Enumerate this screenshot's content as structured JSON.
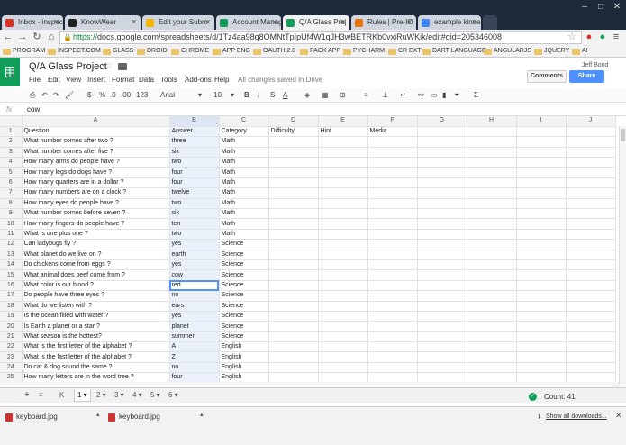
{
  "browser": {
    "tabs": [
      {
        "label": "Inbox - inspect",
        "color": "#d93025"
      },
      {
        "label": "KnowWear",
        "color": "#222222"
      },
      {
        "label": "Edit your Subm",
        "color": "#f4b400"
      },
      {
        "label": "Account Manag",
        "color": "#0f9d58"
      },
      {
        "label": "Q/A Glass Proj",
        "color": "#0f9d58"
      },
      {
        "label": "Rules | Pre-IO",
        "color": "#e8710a"
      },
      {
        "label": "example kinde",
        "color": "#4285f4"
      }
    ],
    "url_scheme": "https://",
    "url_rest": "docs.google.com/spreadsheets/d/1Tz4aa98g8OMNtTpIpUf4W1qJH3wBETRKb0vxiRuWKik/edit#gid=205346008",
    "bookmarks": [
      "PROGRAM",
      "INSPECT.COM",
      "GLASS",
      "DROID",
      "CHROME",
      "APP ENG",
      "OAUTH 2.0",
      "PACK APP",
      "PYCHARM",
      "CR EXT",
      "DART LANGUAGE",
      "ANGULARJS",
      "JQUERY",
      "AI"
    ]
  },
  "doc": {
    "title": "Q/A Glass Project",
    "menu": [
      "File",
      "Edit",
      "View",
      "Insert",
      "Format",
      "Data",
      "Tools",
      "Add-ons",
      "Help"
    ],
    "saved_status": "All changes saved in Drive",
    "user": "Jeff Bond",
    "comments_label": "Comments",
    "share_label": "Share"
  },
  "toolbar": {
    "percent": "%",
    "currency": "$",
    "decimal_less": ".0",
    "decimal_more": ".00",
    "number_format": "123",
    "font": "Arial",
    "font_size": "10",
    "bold": "B",
    "italic": "I",
    "strike": "S",
    "text_color": "A",
    "sum": "Σ"
  },
  "formula_bar": {
    "label": "fx",
    "value": "cow"
  },
  "columns": [
    "A",
    "B",
    "C",
    "D",
    "E",
    "F",
    "G",
    "H",
    "I",
    "J"
  ],
  "rows": [
    [
      "Question",
      "Answer",
      "Category",
      "Difficulty",
      "Hint",
      "Media"
    ],
    [
      "What number comes after two ?",
      "three",
      "Math",
      "",
      "",
      ""
    ],
    [
      "What number comes after five ?",
      "six",
      "Math",
      "",
      "",
      ""
    ],
    [
      "How many arms do people have ?",
      "two",
      "Math",
      "",
      "",
      ""
    ],
    [
      "How many legs do dogs have ?",
      "four",
      "Math",
      "",
      "",
      ""
    ],
    [
      "How many quarters are in a dollar ?",
      "four",
      "Math",
      "",
      "",
      ""
    ],
    [
      "How many numbers are on a clock ?",
      "twelve",
      "Math",
      "",
      "",
      ""
    ],
    [
      "How many eyes do people have ?",
      "two",
      "Math",
      "",
      "",
      ""
    ],
    [
      "What number comes before seven ?",
      "six",
      "Math",
      "",
      "",
      ""
    ],
    [
      "How many fingers do people have ?",
      "ten",
      "Math",
      "",
      "",
      ""
    ],
    [
      "What is one plus one ?",
      "two",
      "Math",
      "",
      "",
      ""
    ],
    [
      "Can ladybugs fly ?",
      "yes",
      "Science",
      "",
      "",
      ""
    ],
    [
      "What planet do we live on ?",
      "earth",
      "Science",
      "",
      "",
      ""
    ],
    [
      "Do chickens come from eggs ?",
      "yes",
      "Science",
      "",
      "",
      ""
    ],
    [
      "What animal does beef come from ?",
      "cow",
      "Science",
      "",
      "",
      ""
    ],
    [
      "What color is our blood ?",
      "red",
      "Science",
      "",
      "",
      ""
    ],
    [
      "Do people have three eyes ?",
      "no",
      "Science",
      "",
      "",
      ""
    ],
    [
      "What do we listen with ?",
      "ears",
      "Science",
      "",
      "",
      ""
    ],
    [
      "Is the ocean filled with water ?",
      "yes",
      "Science",
      "",
      "",
      ""
    ],
    [
      "Is Earth a planet or a star ?",
      "planet",
      "Science",
      "",
      "",
      ""
    ],
    [
      "What season is the hottest?",
      "summer",
      "Science",
      "",
      "",
      ""
    ],
    [
      "What is the first letter of the alphabet ?",
      "A",
      "English",
      "",
      "",
      ""
    ],
    [
      "What is the last letter of the alphabet ?",
      "Z",
      "English",
      "",
      "",
      ""
    ],
    [
      "Do cat & dog sound the same ?",
      "no",
      "English",
      "",
      "",
      ""
    ],
    [
      "How many letters are in the word tree ?",
      "four",
      "English",
      "",
      "",
      ""
    ]
  ],
  "selected_row": 15,
  "sheets": {
    "prev": "K",
    "tabs": [
      "1",
      "2",
      "3",
      "4",
      "5",
      "6"
    ],
    "count_label": "Count: 41"
  },
  "downloads": {
    "items": [
      "keyboard.jpg",
      "keyboard.jpg"
    ],
    "show_all": "Show all downloads..."
  }
}
